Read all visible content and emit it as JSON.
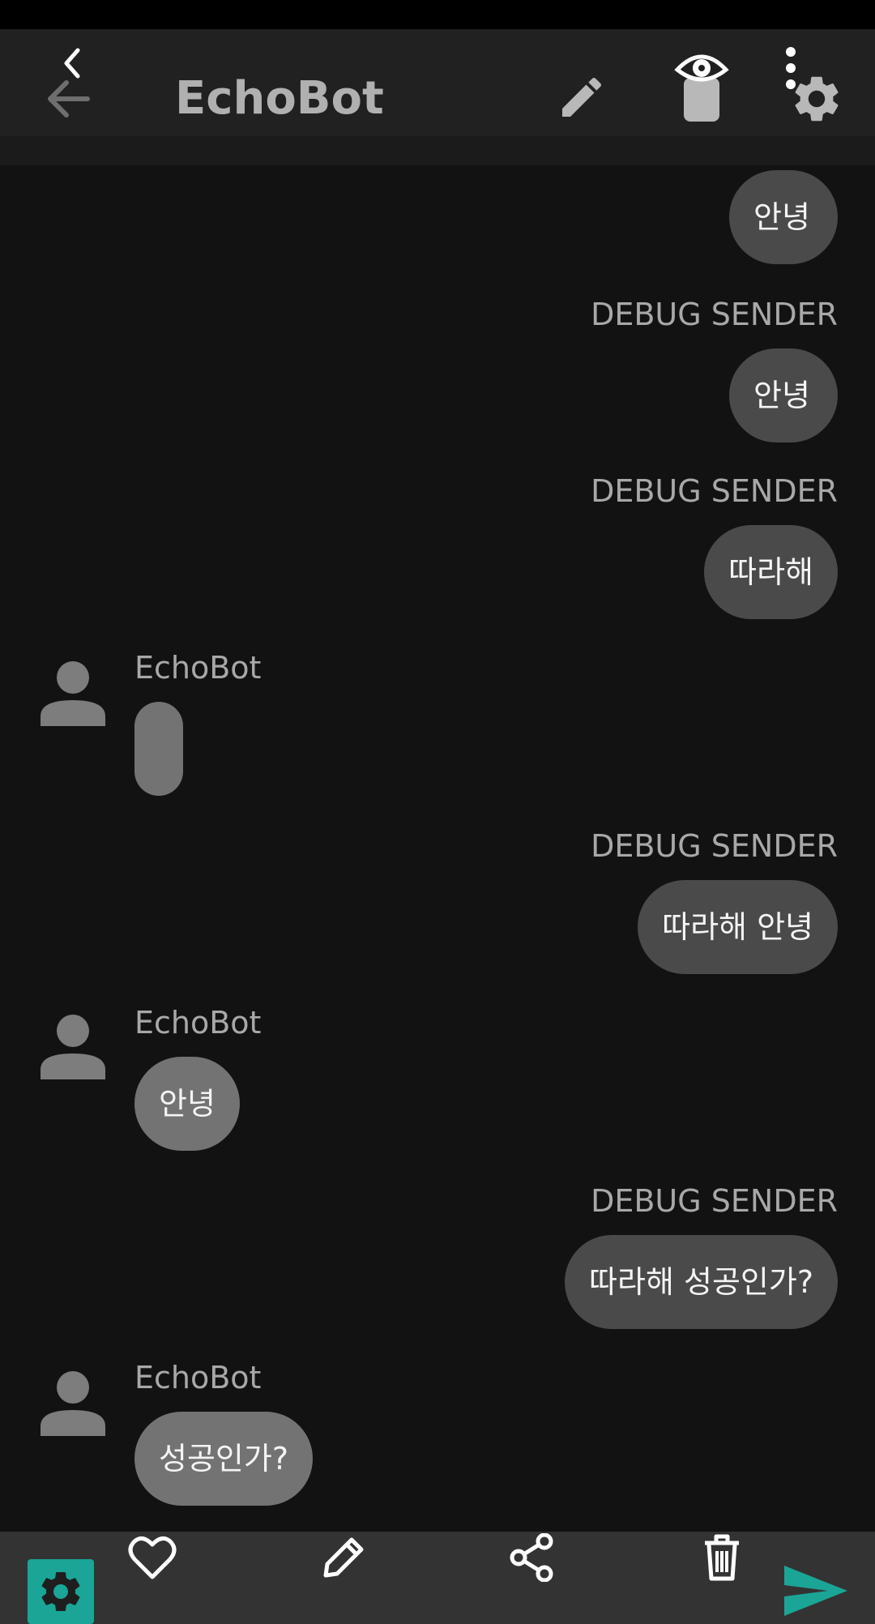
{
  "app": {
    "title": "EchoBot",
    "accent_color": "#1aa596"
  },
  "toolbar": {
    "back_icon": "back-arrow-icon",
    "edit_icon": "pencil-icon",
    "view_icon": "eye-icon",
    "more_icon": "more-vert-icon",
    "settings_icon": "gear-icon"
  },
  "messages": [
    {
      "direction": "out",
      "sender": "",
      "text": "안녕"
    },
    {
      "direction": "out",
      "sender": "DEBUG SENDER",
      "text": "안녕"
    },
    {
      "direction": "out",
      "sender": "DEBUG SENDER",
      "text": "따라해"
    },
    {
      "direction": "in",
      "sender": "EchoBot",
      "text": ""
    },
    {
      "direction": "out",
      "sender": "DEBUG SENDER",
      "text": "따라해 안녕"
    },
    {
      "direction": "in",
      "sender": "EchoBot",
      "text": "안녕"
    },
    {
      "direction": "out",
      "sender": "DEBUG SENDER",
      "text": "따라해 성공인가?"
    },
    {
      "direction": "in",
      "sender": "EchoBot",
      "text": "성공인가?"
    }
  ],
  "bottom_bar": {
    "settings_icon": "gear-icon",
    "like_icon": "heart-icon",
    "edit_icon": "pencil-icon",
    "share_icon": "share-icon",
    "delete_icon": "trash-icon",
    "send_icon": "send-icon"
  }
}
